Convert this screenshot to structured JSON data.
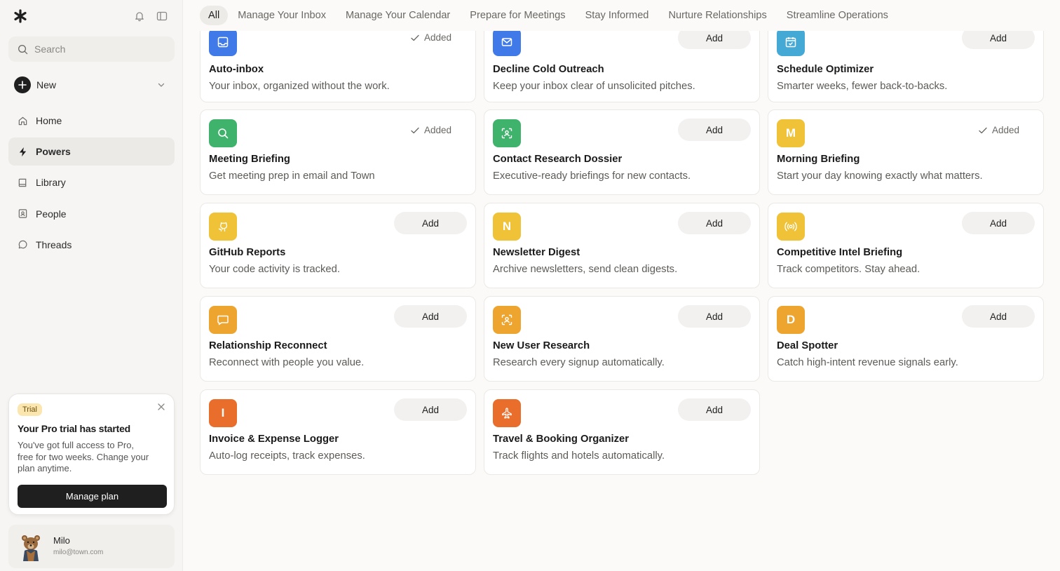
{
  "sidebar": {
    "search_placeholder": "Search",
    "new_label": "New",
    "nav": [
      {
        "label": "Home",
        "icon": "home-icon"
      },
      {
        "label": "Powers",
        "icon": "bolt-icon",
        "active": true
      },
      {
        "label": "Library",
        "icon": "book-icon"
      },
      {
        "label": "People",
        "icon": "contact-card-icon"
      },
      {
        "label": "Threads",
        "icon": "chat-bubble-icon"
      }
    ],
    "trial": {
      "badge": "Trial",
      "title": "Your Pro trial has started",
      "text": "You've got full access to Pro, free for two weeks. Change your plan anytime.",
      "button": "Manage plan"
    },
    "user": {
      "name": "Milo",
      "email": "milo@town.com"
    }
  },
  "tabs": [
    "All",
    "Manage Your Inbox",
    "Manage Your Calendar",
    "Prepare for Meetings",
    "Stay Informed",
    "Nurture Relationships",
    "Streamline Operations"
  ],
  "labels": {
    "add": "Add",
    "added": "Added"
  },
  "cards": [
    {
      "title": "Auto-inbox",
      "desc": "Your inbox, organized without the work.",
      "status": "added",
      "icon": "inbox-icon",
      "color": "#3f7ae8"
    },
    {
      "title": "Decline Cold Outreach",
      "desc": "Keep your inbox clear of unsolicited pitches.",
      "status": "add",
      "icon": "envelope-icon",
      "color": "#3f7ae8"
    },
    {
      "title": "Schedule Optimizer",
      "desc": "Smarter weeks, fewer back-to-backs.",
      "status": "add",
      "icon": "calendar-check-icon",
      "color": "#45a9d6"
    },
    {
      "title": "Meeting Briefing",
      "desc": "Get meeting prep in email and Town",
      "status": "added",
      "icon": "magnifier-icon",
      "color": "#3fb36b"
    },
    {
      "title": "Contact Research Dossier",
      "desc": "Executive-ready briefings for new contacts.",
      "status": "add",
      "icon": "person-scan-icon",
      "color": "#3fb36b"
    },
    {
      "title": "Morning Briefing",
      "desc": "Start your day knowing exactly what matters.",
      "status": "added",
      "icon": "letter-m-icon",
      "letter": "M",
      "color": "#f0c238"
    },
    {
      "title": "GitHub Reports",
      "desc": "Your code activity is tracked.",
      "status": "add",
      "icon": "github-icon",
      "color": "#f0c238"
    },
    {
      "title": "Newsletter Digest",
      "desc": "Archive newsletters, send clean digests.",
      "status": "add",
      "icon": "letter-n-icon",
      "letter": "N",
      "color": "#f0c238"
    },
    {
      "title": "Competitive Intel Briefing",
      "desc": "Track competitors. Stay ahead.",
      "status": "add",
      "icon": "broadcast-icon",
      "color": "#f0c238"
    },
    {
      "title": "Relationship Reconnect",
      "desc": "Reconnect with people you value.",
      "status": "add",
      "icon": "chat-bubble-icon",
      "color": "#eda530"
    },
    {
      "title": "New User Research",
      "desc": "Research every signup automatically.",
      "status": "add",
      "icon": "person-scan-icon",
      "color": "#eda530"
    },
    {
      "title": "Deal Spotter",
      "desc": "Catch high-intent revenue signals early.",
      "status": "add",
      "icon": "letter-d-icon",
      "letter": "D",
      "color": "#eda530"
    },
    {
      "title": "Invoice & Expense Logger",
      "desc": "Auto-log receipts, track expenses.",
      "status": "add",
      "icon": "letter-i-icon",
      "letter": "I",
      "color": "#ea6e2b"
    },
    {
      "title": "Travel & Booking Organizer",
      "desc": "Track flights and hotels automatically.",
      "status": "add",
      "icon": "airplane-icon",
      "color": "#ea6e2b"
    }
  ]
}
